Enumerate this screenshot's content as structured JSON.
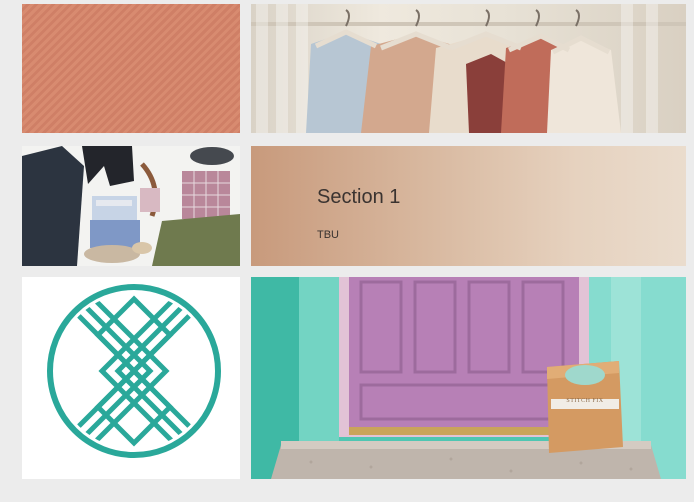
{
  "section": {
    "title": "Section 1",
    "subtitle": "TBU"
  },
  "images": {
    "top_left": "salmon-diagonal-stripes",
    "top_right": "clothes-on-hangers-photo",
    "middle_left": "flat-lay-menswear-photo",
    "bottom_left": "stitch-fix-logo",
    "bottom_right": "front-door-with-box-photo"
  },
  "box_label": "STITCH FIX",
  "colors": {
    "stripe": "#d88b70",
    "logo_teal": "#2aa89a",
    "door_pink": "#b780b6",
    "wall_teal": "#4fc6b2",
    "background": "#ececec"
  }
}
